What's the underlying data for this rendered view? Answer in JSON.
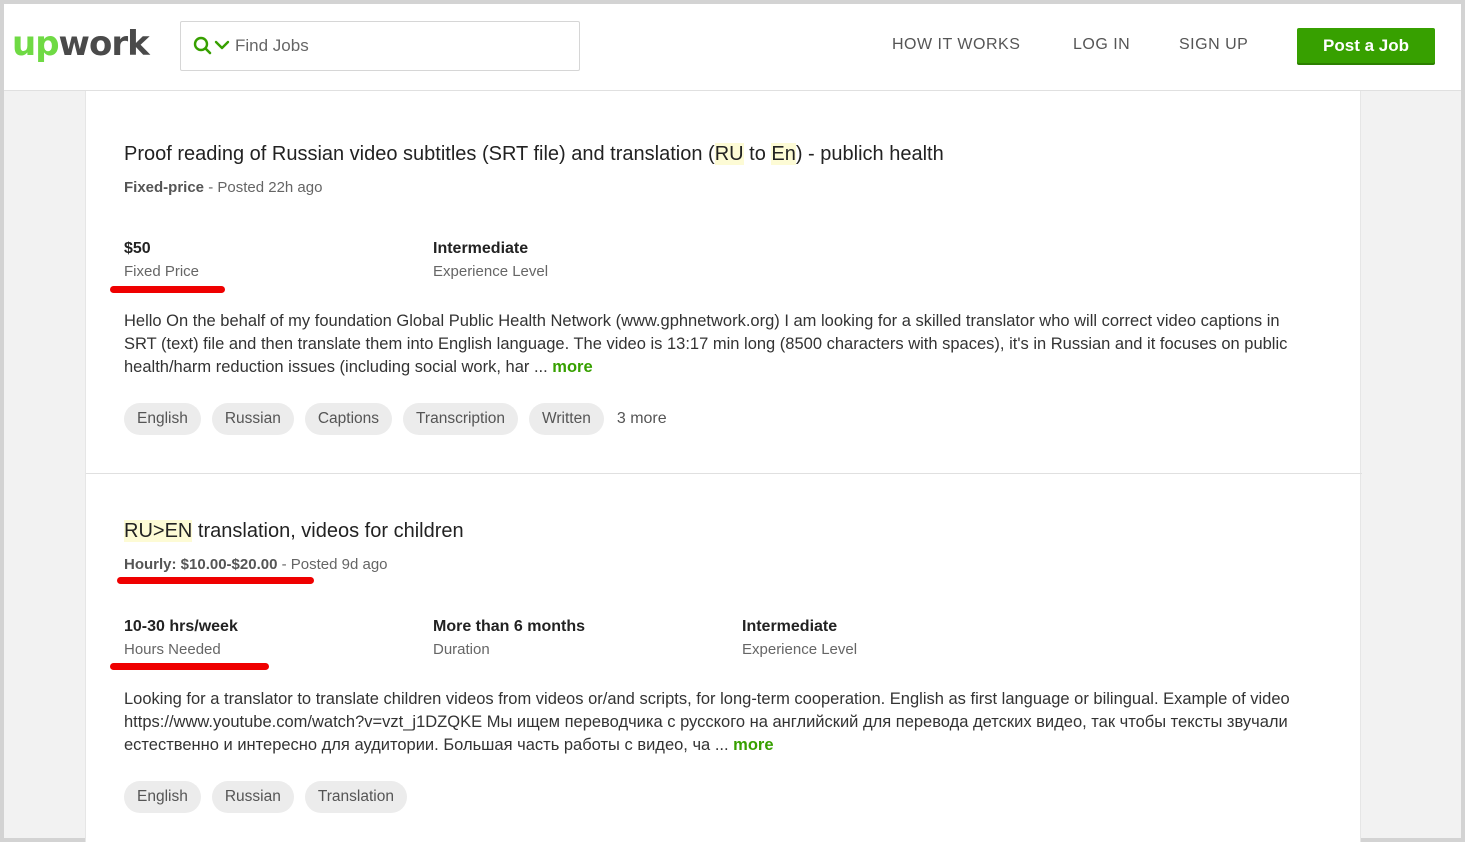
{
  "header": {
    "logo_up": "up",
    "logo_work": "work",
    "search_placeholder": "Find Jobs",
    "nav": {
      "how_it_works": "HOW IT WORKS",
      "log_in": "LOG IN",
      "sign_up": "SIGN UP"
    },
    "post_job": "Post a Job",
    "colors": {
      "brand_green": "#6fda44",
      "button_green": "#37a000"
    }
  },
  "jobs": [
    {
      "title_pre": "Proof reading of Russian video subtitles (SRT file) and translation (",
      "title_hl1": "RU",
      "title_mid": " to ",
      "title_hl2": "En",
      "title_post": ") - publich health",
      "type": "Fixed-price",
      "posted": " - Posted 22h ago",
      "stats": [
        {
          "value": "$50",
          "label": "Fixed Price"
        },
        {
          "value": "Intermediate",
          "label": "Experience Level"
        }
      ],
      "description": "Hello On the behalf of my foundation Global Public Health Network (www.gphnetwork.org) I am looking for a skilled translator who will correct video captions in SRT (text) file and then translate them into English language. The video is 13:17 min long (8500 characters with spaces), it's in Russian and it focuses on public health/harm reduction issues (including social work, har ... ",
      "more": "more",
      "tags": [
        "English",
        "Russian",
        "Captions",
        "Transcription",
        "Written"
      ],
      "tags_more": "3 more"
    },
    {
      "title_hl": "RU>EN",
      "title_post": " translation, videos for children",
      "type": "Hourly: $10.00-$20.00",
      "posted": " - Posted 9d ago",
      "stats": [
        {
          "value": "10-30 hrs/week",
          "label": "Hours Needed"
        },
        {
          "value": "More than 6 months",
          "label": "Duration"
        },
        {
          "value": "Intermediate",
          "label": "Experience Level"
        }
      ],
      "description": "Looking for a translator to translate children videos from videos or/and scripts, for long-term cooperation. English as first language or bilingual. Example of video https://www.youtube.com/watch?v=vzt_j1DZQKE Мы ищем переводчика с русского на английский для перевода детских видео, так чтобы тексты звучали естественно и интересно для аудитории. Большая часть работы с видео, ча ... ",
      "more": "more",
      "tags": [
        "English",
        "Russian",
        "Translation"
      ]
    }
  ],
  "annotation_color": "#ef0000"
}
